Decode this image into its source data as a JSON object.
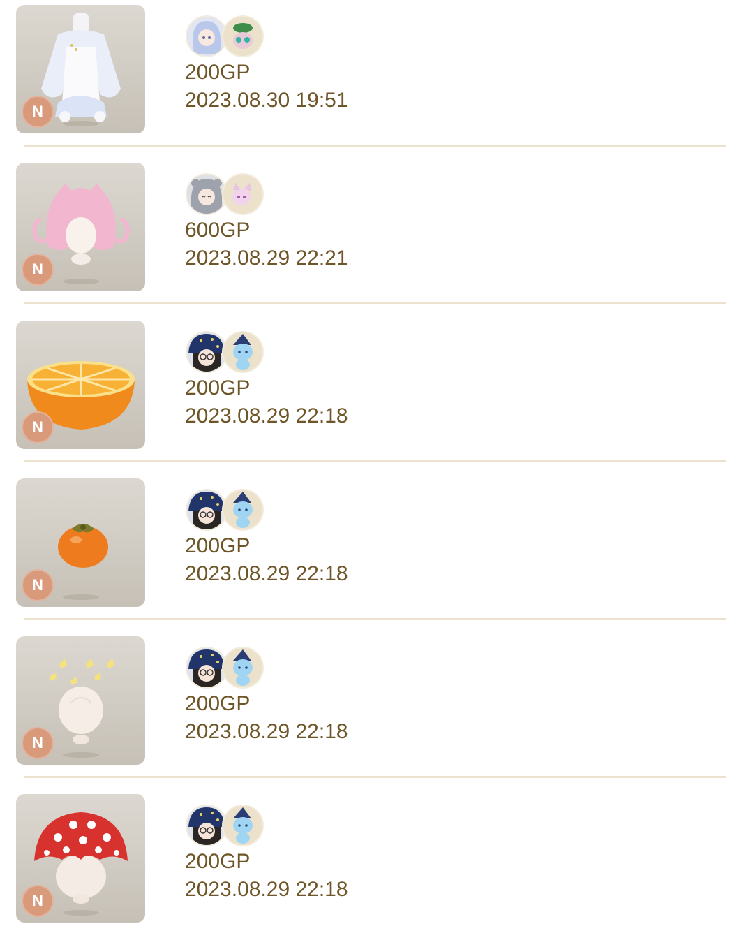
{
  "items": [
    {
      "rarity": "N",
      "price": "200GP",
      "date": "2023.08.30 19:51",
      "item_icon": "dress-outfit-icon",
      "user_avatar": "blue-hair-girl-avatar",
      "pet_avatar": "green-hat-pet-avatar"
    },
    {
      "rarity": "N",
      "price": "600GP",
      "date": "2023.08.29 22:21",
      "item_icon": "pink-hair-icon",
      "user_avatar": "silver-hair-girl-avatar",
      "pet_avatar": "pink-pet-avatar"
    },
    {
      "rarity": "N",
      "price": "200GP",
      "date": "2023.08.29 22:18",
      "item_icon": "orange-half-icon",
      "user_avatar": "starry-hat-girl-avatar",
      "pet_avatar": "blue-cat-pet-avatar"
    },
    {
      "rarity": "N",
      "price": "200GP",
      "date": "2023.08.29 22:18",
      "item_icon": "persimmon-icon",
      "user_avatar": "starry-hat-girl-avatar",
      "pet_avatar": "blue-cat-pet-avatar"
    },
    {
      "rarity": "N",
      "price": "200GP",
      "date": "2023.08.29 22:18",
      "item_icon": "yellow-butterflies-icon",
      "user_avatar": "starry-hat-girl-avatar",
      "pet_avatar": "blue-cat-pet-avatar"
    },
    {
      "rarity": "N",
      "price": "200GP",
      "date": "2023.08.29 22:18",
      "item_icon": "mushroom-hat-icon",
      "user_avatar": "starry-hat-girl-avatar",
      "pet_avatar": "blue-cat-pet-avatar"
    }
  ],
  "colors": {
    "text": "#6e5628",
    "divider": "#ece3cf",
    "rarity_badge": "#d99a7c",
    "thumb_bg": "#d2cdc5"
  }
}
